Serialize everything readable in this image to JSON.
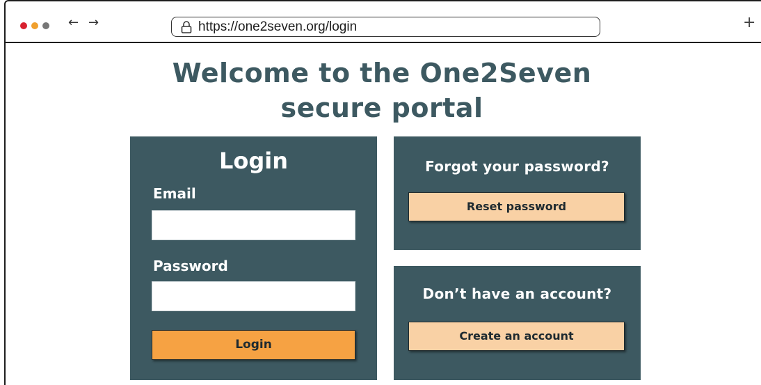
{
  "browser": {
    "url": "https://one2seven.org/login",
    "traffic_lights": [
      "#d8212f",
      "#f0a02e",
      "#777777"
    ],
    "back_icon": "←",
    "forward_icon": "→",
    "new_tab_icon": "+"
  },
  "page": {
    "heading_line1": "Welcome to the One2Seven",
    "heading_line2": "secure portal"
  },
  "login": {
    "title": "Login",
    "email_label": "Email",
    "email_value": "",
    "password_label": "Password",
    "password_value": "",
    "submit_label": "Login"
  },
  "forgot": {
    "title": "Forgot your password?",
    "button_label": "Reset password"
  },
  "account": {
    "title": "Don’t have an account?",
    "button_label": "Create an account"
  },
  "colors": {
    "panel": "#3d5961",
    "primary_button": "#f6a243",
    "secondary_button": "#f9d1a5"
  }
}
